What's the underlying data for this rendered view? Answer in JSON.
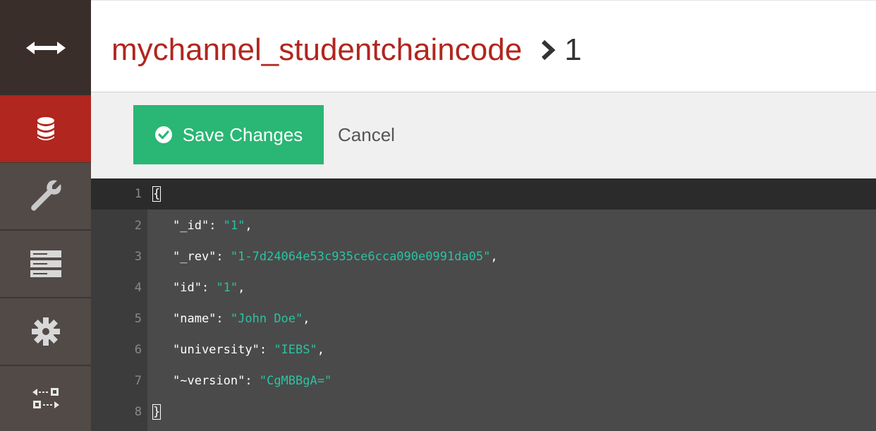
{
  "sidebar": {
    "items": [
      {
        "name": "toggle",
        "icon": "arrows-horizontal-icon"
      },
      {
        "name": "databases",
        "icon": "database-icon",
        "active": true
      },
      {
        "name": "setup",
        "icon": "wrench-icon"
      },
      {
        "name": "logs",
        "icon": "server-stack-icon"
      },
      {
        "name": "config",
        "icon": "gear-icon"
      },
      {
        "name": "replication",
        "icon": "replication-icon"
      }
    ],
    "colors": {
      "background": "#514a47",
      "active": "#b1261e",
      "toggle_bg": "#3a2e2b"
    }
  },
  "header": {
    "database": "mychannel_studentchaincode",
    "separator_icon": "chevron-right-icon",
    "document_id": "1"
  },
  "toolbar": {
    "save_label": "Save Changes",
    "save_icon": "check-circle-icon",
    "cancel_label": "Cancel",
    "save_color": "#2ab674"
  },
  "editor": {
    "lines": [
      {
        "num": "1",
        "open": "{"
      },
      {
        "num": "2",
        "key": "\"_id\"",
        "value": "\"1\"",
        "comma": ","
      },
      {
        "num": "3",
        "key": "\"_rev\"",
        "value": "\"1-7d24064e53c935ce6cca090e0991da05\"",
        "comma": ","
      },
      {
        "num": "4",
        "key": "\"id\"",
        "value": "\"1\"",
        "comma": ","
      },
      {
        "num": "5",
        "key": "\"name\"",
        "value": "\"John Doe\"",
        "comma": ","
      },
      {
        "num": "6",
        "key": "\"university\"",
        "value": "\"IEBS\"",
        "comma": ","
      },
      {
        "num": "7",
        "key": "\"~version\"",
        "value": "\"CgMBBgA=\"",
        "comma": ""
      },
      {
        "num": "8",
        "close": "}"
      }
    ],
    "colors": {
      "string": "#2ac3a2",
      "background": "#4a4a4a",
      "active_line": "#2b2b2b"
    }
  }
}
